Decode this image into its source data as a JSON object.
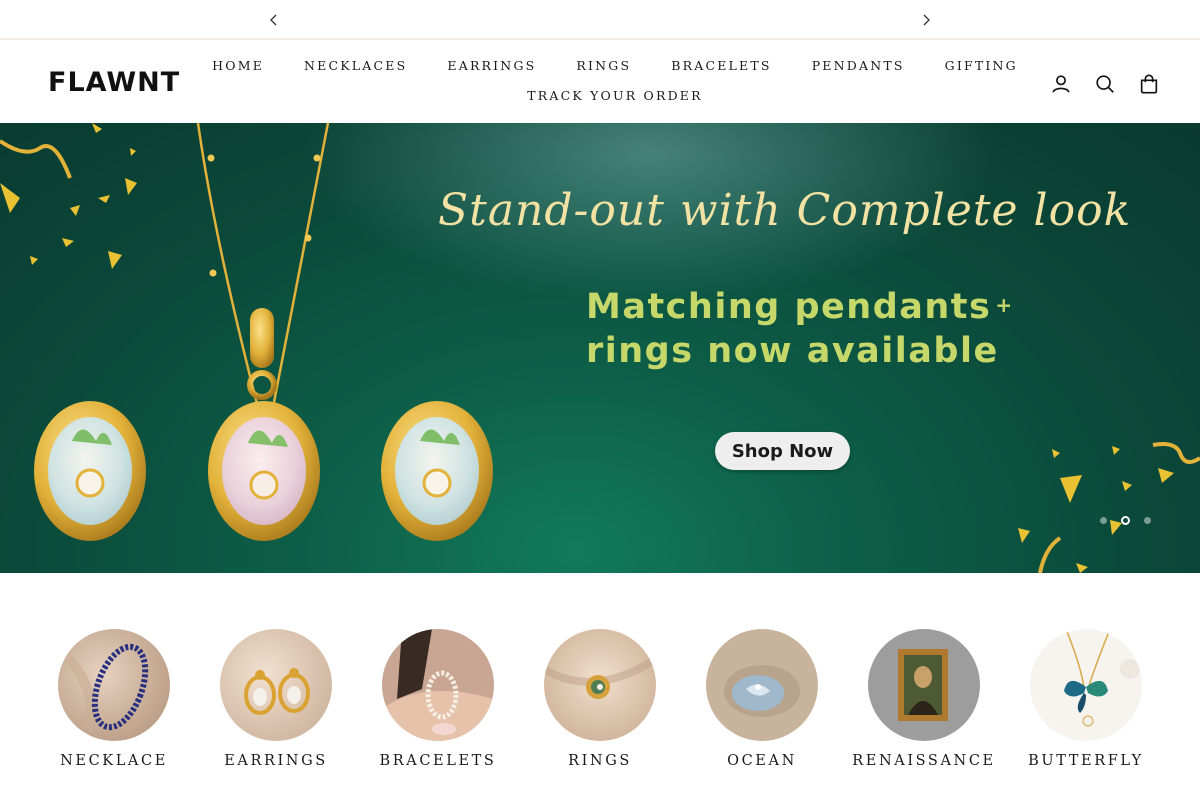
{
  "announcement": {
    "prev_icon": "chevron-left-icon",
    "next_icon": "chevron-right-icon"
  },
  "header": {
    "logo_text": "FLAWNT",
    "nav_primary": [
      "HOME",
      "NECKLACES",
      "EARRINGS",
      "RINGS",
      "BRACELETS",
      "PENDANTS",
      "GIFTING"
    ],
    "nav_secondary": [
      "TRACK YOUR ORDER"
    ],
    "icons": [
      "account-icon",
      "search-icon",
      "cart-icon"
    ]
  },
  "hero": {
    "script_title": "Stand-out with Complete look",
    "headline_line1": "Matching pendants",
    "headline_plus": "+",
    "headline_line2": "rings now available",
    "cta_label": "Shop Now",
    "slide_count": 3,
    "active_slide": 2,
    "colors": {
      "background": "#0d5f48",
      "script": "#f2e2a3",
      "headline": "#c7d86a",
      "gold": "#e2b23a"
    }
  },
  "categories": [
    {
      "label": "NECKLACE"
    },
    {
      "label": "EARRINGS"
    },
    {
      "label": "BRACELETS"
    },
    {
      "label": "RINGS"
    },
    {
      "label": "OCEAN"
    },
    {
      "label": "RENAISSANCE"
    },
    {
      "label": "BUTTERFLY"
    }
  ]
}
